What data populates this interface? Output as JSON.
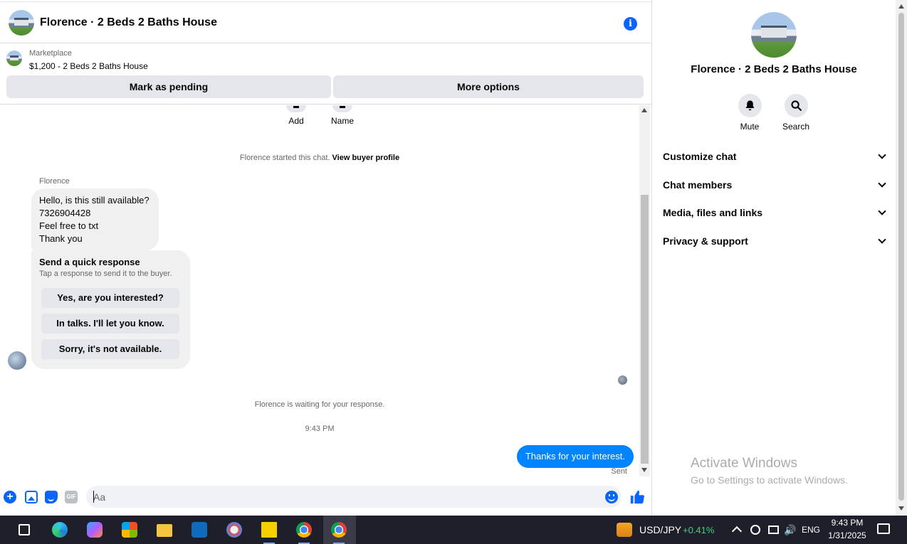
{
  "header": {
    "title": "Florence · 2 Beds 2 Baths House"
  },
  "listing": {
    "kind": "Marketplace",
    "title": "$1,200 - 2 Beds 2 Baths House",
    "mark_pending_label": "Mark as pending",
    "more_options_label": "More options"
  },
  "conversation": {
    "top_actions": [
      {
        "label": "Add"
      },
      {
        "label": "Name"
      }
    ],
    "started_text": "Florence started this chat.",
    "view_profile_label": "View buyer profile",
    "sender_name": "Florence",
    "incoming_lines": [
      "Hello, is this still available?",
      "7326904428",
      "Feel free to txt",
      "Thank you"
    ],
    "quick_response": {
      "title": "Send a quick response",
      "subtitle": "Tap a response to send it to the buyer.",
      "options": [
        "Yes, are you interested?",
        "In talks. I'll let you know.",
        "Sorry, it's not available."
      ]
    },
    "waiting_text": "Florence is waiting for your response.",
    "time": "9:43 PM",
    "outgoing": "Thanks for your interest.",
    "sent_status": "Sent"
  },
  "composer": {
    "placeholder": "Aa",
    "gif_label": "GIF"
  },
  "info_panel": {
    "title": "Florence · 2 Beds 2 Baths House",
    "actions": [
      {
        "label": "Mute",
        "icon": "bell-icon"
      },
      {
        "label": "Search",
        "icon": "search-icon"
      }
    ],
    "sections": [
      "Customize chat",
      "Chat members",
      "Media, files and links",
      "Privacy & support"
    ]
  },
  "watermark": {
    "title": "Activate Windows",
    "subtitle": "Go to Settings to activate Windows."
  },
  "taskbar": {
    "stock_label": "USD/JPY",
    "stock_change": "+0.41%",
    "lang": "ENG",
    "time": "9:43 PM",
    "date": "1/31/2025"
  },
  "colors": {
    "accent": "#0866ff",
    "outgoing_bubble": "#0084ff",
    "incoming_bubble": "#f0f0f0",
    "taskbar": "#1f1f2c"
  }
}
